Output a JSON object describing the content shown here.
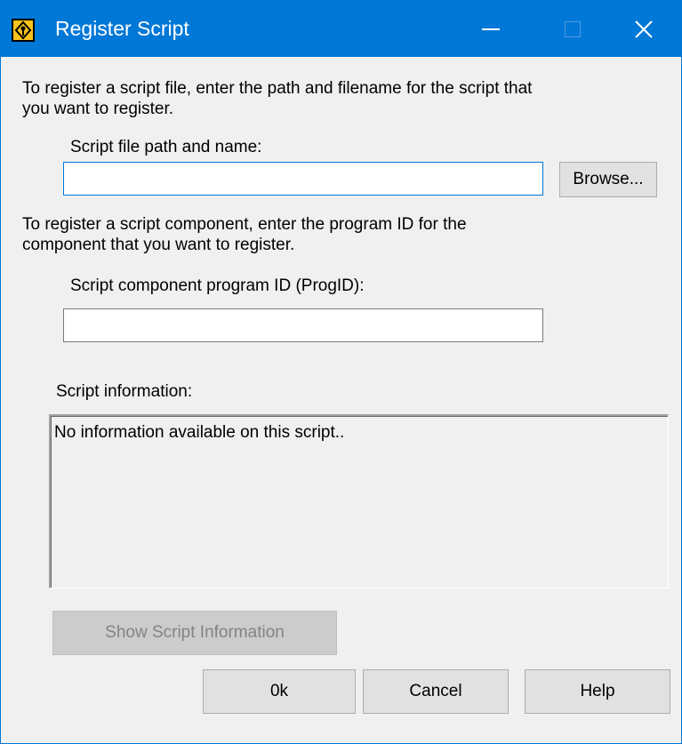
{
  "window": {
    "title": "Register Script"
  },
  "colors": {
    "titlebar": "#0078d7",
    "face": "#f0f0f0",
    "button": "#e1e1e1"
  },
  "icons": {
    "app": "register-script-app-icon",
    "minimize": "minimize-icon",
    "maximize": "maximize-icon",
    "close": "close-icon"
  },
  "script_file": {
    "instructions_line1": "To register a script file, enter the path and filename for the script that",
    "instructions_line2": "you want to register.",
    "label": "Script file path and name:",
    "value": "",
    "browse_label": "Browse..."
  },
  "component": {
    "instructions_line1": "To register a script component, enter the program ID for the",
    "instructions_line2": "component that you want to register.",
    "label": "Script component program ID (ProgID):",
    "value": ""
  },
  "info": {
    "label": "Script information:",
    "text": "No information available on this script.."
  },
  "buttons": {
    "show_info": "Show Script Information",
    "ok": "0k",
    "cancel": "Cancel",
    "help": "Help"
  }
}
